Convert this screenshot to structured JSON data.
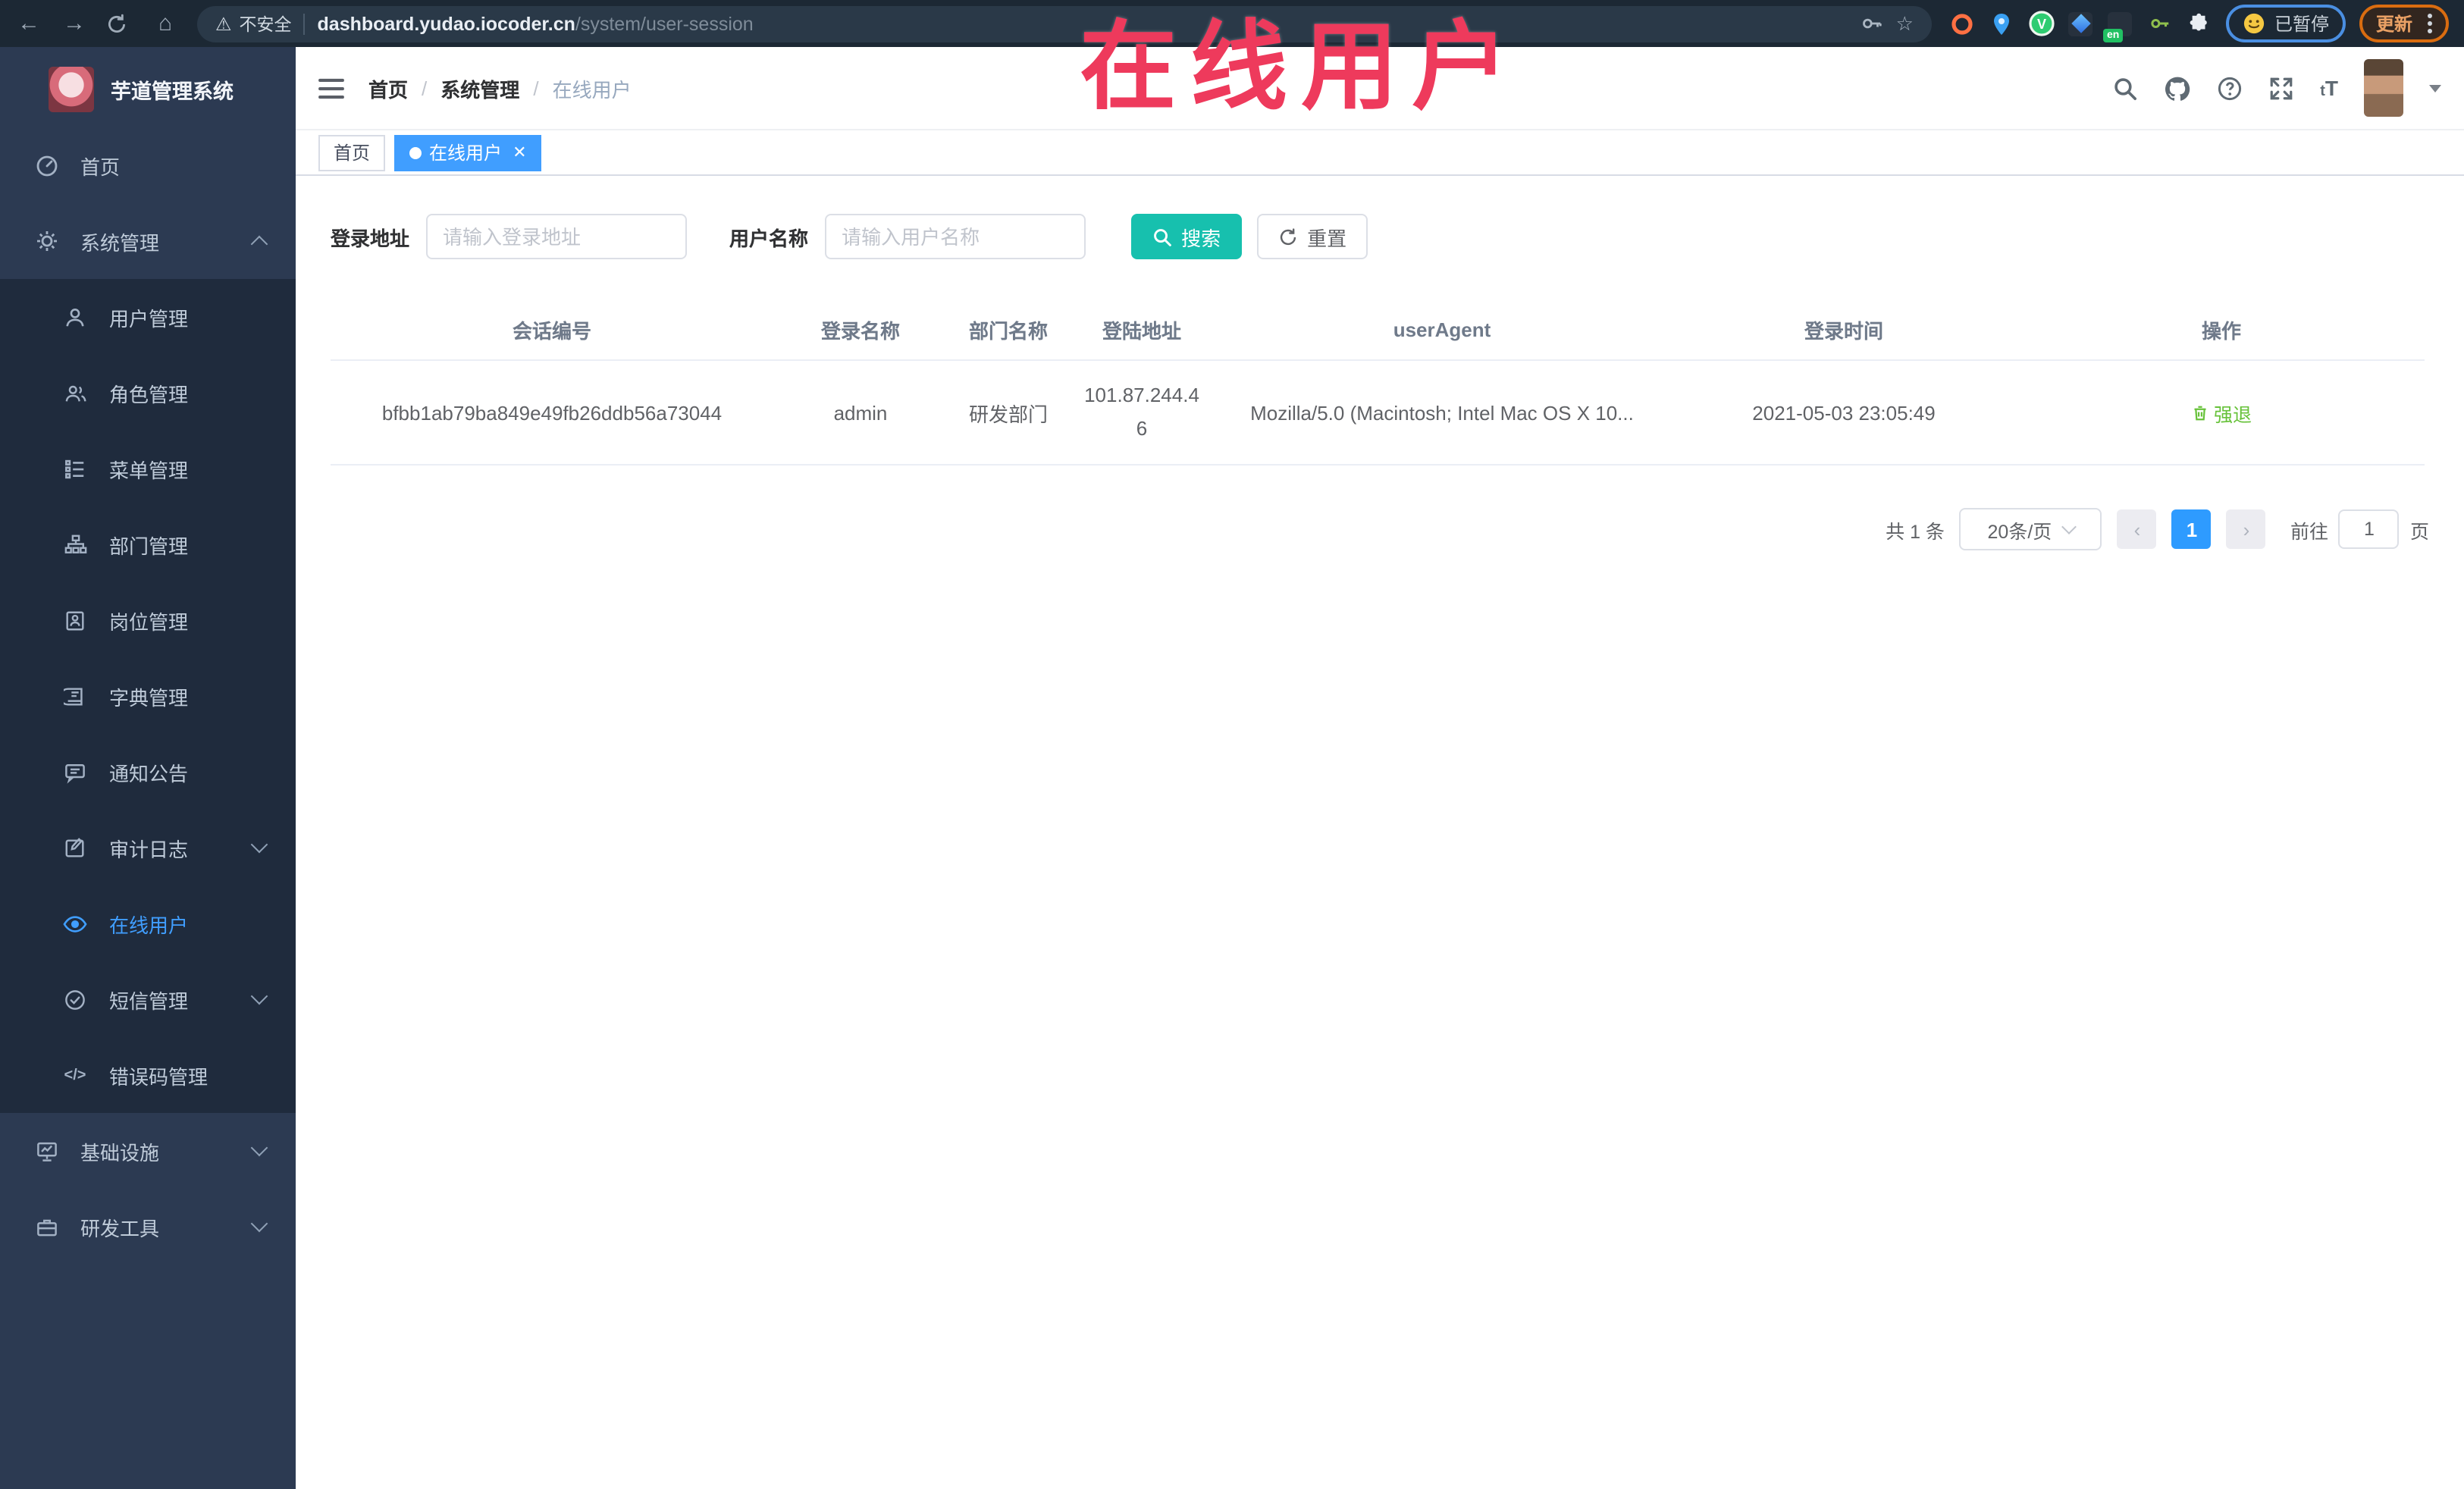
{
  "browser": {
    "security_label": "不安全",
    "url_host": "dashboard.yudao.iocoder.cn",
    "url_path": "/system/user-session",
    "paused_label": "已暂停",
    "update_label": "更新"
  },
  "overlay": {
    "title": "在线用户"
  },
  "sidebar": {
    "app_title": "芋道管理系统",
    "items": [
      {
        "label": "首页",
        "icon": "dashboard-icon"
      },
      {
        "label": "系统管理",
        "icon": "gear-icon"
      },
      {
        "label": "用户管理",
        "icon": "user-icon"
      },
      {
        "label": "角色管理",
        "icon": "users-icon"
      },
      {
        "label": "菜单管理",
        "icon": "menu-list-icon"
      },
      {
        "label": "部门管理",
        "icon": "org-tree-icon"
      },
      {
        "label": "岗位管理",
        "icon": "post-badge-icon"
      },
      {
        "label": "字典管理",
        "icon": "dictionary-icon"
      },
      {
        "label": "通知公告",
        "icon": "announcement-icon"
      },
      {
        "label": "审计日志",
        "icon": "audit-log-icon"
      },
      {
        "label": "在线用户",
        "icon": "online-user-icon"
      },
      {
        "label": "短信管理",
        "icon": "sms-icon"
      },
      {
        "label": "错误码管理",
        "icon": "code-icon"
      },
      {
        "label": "基础设施",
        "icon": "infrastructure-icon"
      },
      {
        "label": "研发工具",
        "icon": "dev-tools-icon"
      }
    ]
  },
  "header": {
    "breadcrumb": [
      "首页",
      "系统管理",
      "在线用户"
    ]
  },
  "tabs": [
    {
      "label": "首页"
    },
    {
      "label": "在线用户"
    }
  ],
  "filters": {
    "login_address_label": "登录地址",
    "login_address_placeholder": "请输入登录地址",
    "username_label": "用户名称",
    "username_placeholder": "请输入用户名称",
    "search_label": "搜索",
    "reset_label": "重置"
  },
  "table": {
    "columns": [
      "会话编号",
      "登录名称",
      "部门名称",
      "登陆地址",
      "userAgent",
      "登录时间",
      "操作"
    ],
    "rows": [
      {
        "session_id": "bfbb1ab79ba849e49fb26ddb56a73044",
        "username": "admin",
        "dept": "研发部门",
        "ip": "101.87.244.46",
        "user_agent": "Mozilla/5.0 (Macintosh; Intel Mac OS X 10...",
        "login_time": "2021-05-03 23:05:49",
        "action_label": "强退"
      }
    ]
  },
  "pagination": {
    "total_label": "共 1 条",
    "page_size_label": "20条/页",
    "current_page": "1",
    "goto_label": "前往",
    "goto_value": "1",
    "page_unit_label": "页"
  },
  "colors": {
    "accent": "#409eff",
    "search_button": "#17c0ae",
    "action_success": "#67c23a",
    "overlay_red": "#ee3a5c",
    "sidebar_bg": "#2c3a52",
    "submenu_bg": "#1f2b3d",
    "toolbar_bg": "#1c2834"
  }
}
